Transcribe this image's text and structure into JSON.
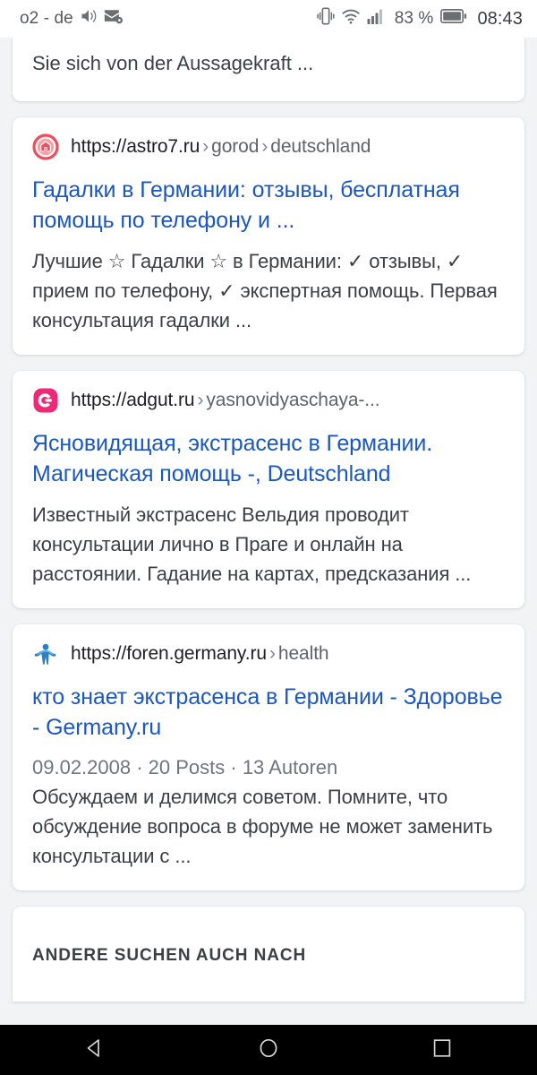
{
  "status_bar": {
    "carrier": "o2 - de",
    "volume_icon": "volume-on-icon",
    "mail_icon": "mail-settings-icon",
    "vibrate_icon": "vibrate-icon",
    "wifi_icon": "wifi-icon",
    "signal_icon": "cellular-signal-icon",
    "battery_percent": "83 %",
    "battery_icon": "battery-icon",
    "clock": "08:43"
  },
  "partial_result_top": {
    "snippet_tail": "Sie sich von der Aussagekraft ..."
  },
  "results": [
    {
      "favicon": "astro7-star-icon",
      "url_domain": "https://astro7.ru",
      "url_path": [
        "gorod",
        "deutschland"
      ],
      "title": "Гадалки в Германии: отзывы, бесплатная помощь по телефону и ...",
      "meta": "",
      "description": "Лучшие ☆ Гадалки ☆ в Германии: ✓ отзывы, ✓ прием по телефону, ✓ экспертная помощь. Первая консультация гадалки ..."
    },
    {
      "favicon": "adgut-g-icon",
      "url_domain": "https://adgut.ru",
      "url_path": [
        "yasnovidyaschaya-..."
      ],
      "title": "Ясновидящая, экстрасенс в Германии. Магическая помощь -, Deutschland",
      "meta": "",
      "description": "Известный экстрасенс Вельдия проводит консультации лично в Праге и онлайн на расстоянии. Гадание на картах, предсказания ..."
    },
    {
      "favicon": "germany-ru-person-icon",
      "url_domain": "https://foren.germany.ru",
      "url_path": [
        "health"
      ],
      "title": "кто знает экстрасенса в Германии - Здоровье - Germany.ru",
      "meta": "09.02.2008 · 20 Posts · 13 Autoren",
      "description": "Обсуждаем и делимся советом. Помните, что обсуждение вопроса в форуме не может заменить консультации с ..."
    }
  ],
  "related_section": {
    "heading": "ANDERE SUCHEN AUCH NACH"
  },
  "nav_bar": {
    "back_icon": "back-triangle-icon",
    "home_icon": "home-circle-icon",
    "recents_icon": "recents-square-icon"
  },
  "colors": {
    "page_background": "#f1f3f4",
    "card_background": "#ffffff",
    "link": "#1a56c4",
    "text_primary": "#3c4043",
    "text_secondary": "#5f6368",
    "nav_background": "#000000"
  }
}
